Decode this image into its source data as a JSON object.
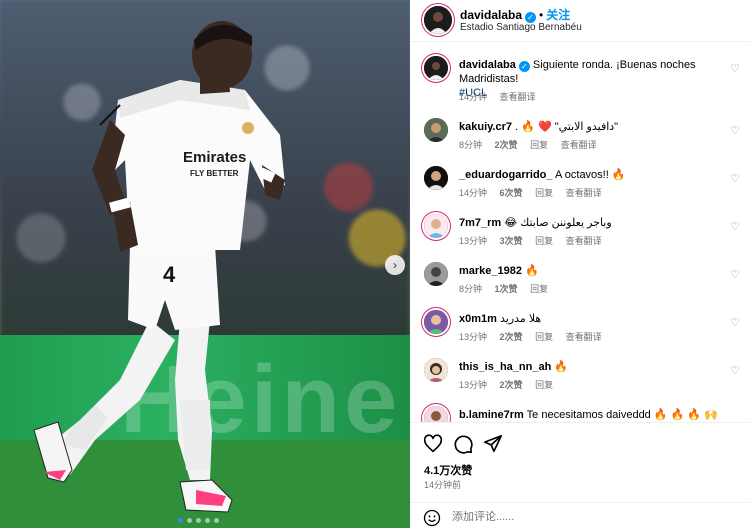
{
  "header": {
    "username": "davidalaba",
    "follow_label": "关注",
    "location": "Estadio Santiago Bernabéu",
    "more_icon": "more-horizontal-icon"
  },
  "caption": {
    "username": "davidalaba",
    "text": "Siguiente ronda. ¡Buenas noches Madridistas!",
    "hashtag": "#UCL",
    "time": "14分钟",
    "translate": "查看翻译"
  },
  "comments": [
    {
      "username": "kakuiy.cr7",
      "text": ". 🔥 ❤️ \"دافيدو الابتي\"",
      "time": "8分钟",
      "likes": "2次赞",
      "reply": "回复",
      "translate": "查看翻译"
    },
    {
      "username": "_eduardogarrido_",
      "text": "A octavos!! 🔥",
      "time": "14分钟",
      "likes": "6次赞",
      "reply": "回复",
      "translate": "查看翻译"
    },
    {
      "username": "7m7_rm",
      "text": "😂 وباجر يعلوننن صابتك",
      "time": "13分钟",
      "likes": "3次赞",
      "reply": "回复",
      "translate": "查看翻译"
    },
    {
      "username": "marke_1982",
      "text": "🔥",
      "time": "8分钟",
      "likes": "1次赞",
      "reply": "回复",
      "translate": ""
    },
    {
      "username": "x0m1m",
      "text": "هلا مدريد",
      "time": "13分钟",
      "likes": "2次赞",
      "reply": "回复",
      "translate": "查看翻译"
    },
    {
      "username": "this_is_ha_nn_ah",
      "text": "🔥",
      "time": "13分钟",
      "likes": "2次赞",
      "reply": "回复",
      "translate": ""
    },
    {
      "username": "b.lamine7rm",
      "text": "Te necesitamos daiveddd 🔥 🔥 🔥 🙌",
      "time": "",
      "likes": "",
      "reply": "",
      "translate": ""
    }
  ],
  "post": {
    "likes": "4.1万次赞",
    "time": "14分钟前",
    "comment_placeholder": "添加评论......"
  },
  "media": {
    "ad_text": "Heine",
    "jersey_text": "Emirates FLY BETTER",
    "shirt_number": "4"
  },
  "colors": {
    "accent": "#0095f6",
    "ring": "#d62976",
    "like_red": "#ed4956"
  },
  "icons": {
    "actions": [
      "heart-icon",
      "comment-icon",
      "share-icon"
    ],
    "compose": "emoji-icon"
  }
}
